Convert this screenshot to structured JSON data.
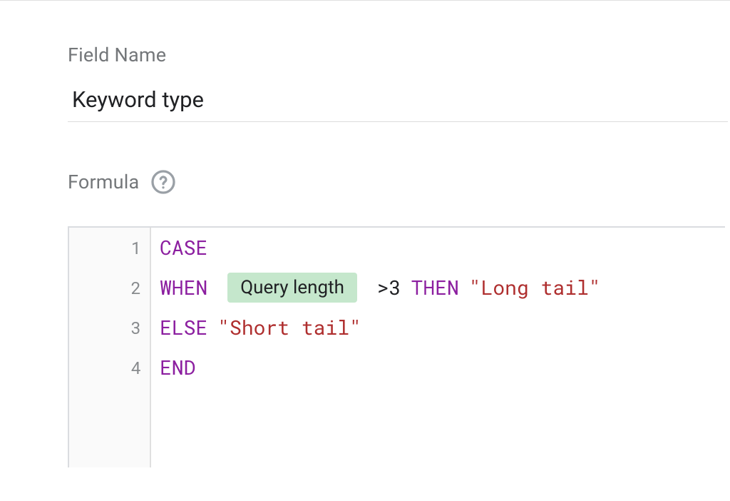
{
  "fieldName": {
    "label": "Field Name",
    "value": "Keyword type"
  },
  "formula": {
    "label": "Formula",
    "lines": {
      "l1": {
        "num": "1",
        "kw": "CASE"
      },
      "l2": {
        "num": "2",
        "kw_when": "WHEN",
        "chip": "Query length",
        "op": ">3",
        "kw_then": "THEN",
        "str": "\"Long tail\""
      },
      "l3": {
        "num": "3",
        "kw_else": "ELSE",
        "str": "\"Short tail\""
      },
      "l4": {
        "num": "4",
        "kw": "END"
      }
    }
  }
}
